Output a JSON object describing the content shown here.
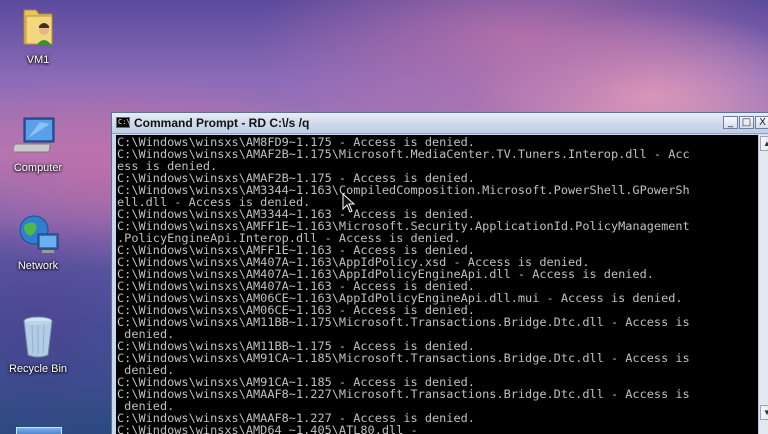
{
  "desktop": {
    "icons": [
      {
        "label": "VM1",
        "icon": "folder-user-icon"
      },
      {
        "label": "Computer",
        "icon": "computer-icon"
      },
      {
        "label": "Network",
        "icon": "network-globe-icon"
      },
      {
        "label": "Recycle Bin",
        "icon": "recycle-bin-icon"
      }
    ]
  },
  "window": {
    "title": "Command Prompt - RD  C:\\/s /q",
    "title_icon_text": "C:\\",
    "controls": {
      "minimize": "_",
      "maximize": "□",
      "close": "X"
    },
    "console_lines": [
      "C:\\Windows\\winsxs\\AM8FD9~1.175 - Access is denied.",
      "C:\\Windows\\winsxs\\AMAF2B~1.175\\Microsoft.MediaCenter.TV.Tuners.Interop.dll - Acc",
      "ess is denied.",
      "C:\\Windows\\winsxs\\AMAF2B~1.175 - Access is denied.",
      "C:\\Windows\\winsxs\\AM3344~1.163\\CompiledComposition.Microsoft.PowerShell.GPowerSh",
      "ell.dll - Access is denied.",
      "C:\\Windows\\winsxs\\AM3344~1.163 - Access is denied.",
      "C:\\Windows\\winsxs\\AMFF1E~1.163\\Microsoft.Security.ApplicationId.PolicyManagement",
      ".PolicyEngineApi.Interop.dll - Access is denied.",
      "C:\\Windows\\winsxs\\AMFF1E~1.163 - Access is denied.",
      "C:\\Windows\\winsxs\\AM407A~1.163\\AppIdPolicy.xsd - Access is denied.",
      "C:\\Windows\\winsxs\\AM407A~1.163\\AppIdPolicyEngineApi.dll - Access is denied.",
      "C:\\Windows\\winsxs\\AM407A~1.163 - Access is denied.",
      "C:\\Windows\\winsxs\\AM06CE~1.163\\AppIdPolicyEngineApi.dll.mui - Access is denied.",
      "C:\\Windows\\winsxs\\AM06CE~1.163 - Access is denied.",
      "C:\\Windows\\winsxs\\AM11BB~1.175\\Microsoft.Transactions.Bridge.Dtc.dll - Access is",
      " denied.",
      "C:\\Windows\\winsxs\\AM11BB~1.175 - Access is denied.",
      "C:\\Windows\\winsxs\\AM91CA~1.185\\Microsoft.Transactions.Bridge.Dtc.dll - Access is",
      " denied.",
      "C:\\Windows\\winsxs\\AM91CA~1.185 - Access is denied.",
      "C:\\Windows\\winsxs\\AMAAF8~1.227\\Microsoft.Transactions.Bridge.Dtc.dll - Access is",
      " denied.",
      "C:\\Windows\\winsxs\\AMAAF8~1.227 - Access is denied.",
      "C:\\Windows\\winsxs\\AMD64_~1.405\\ATL80.dll -"
    ]
  },
  "colors": {
    "console_bg": "#000000",
    "console_fg": "#c0c0c0",
    "titlebar": "#cfdaeb"
  }
}
